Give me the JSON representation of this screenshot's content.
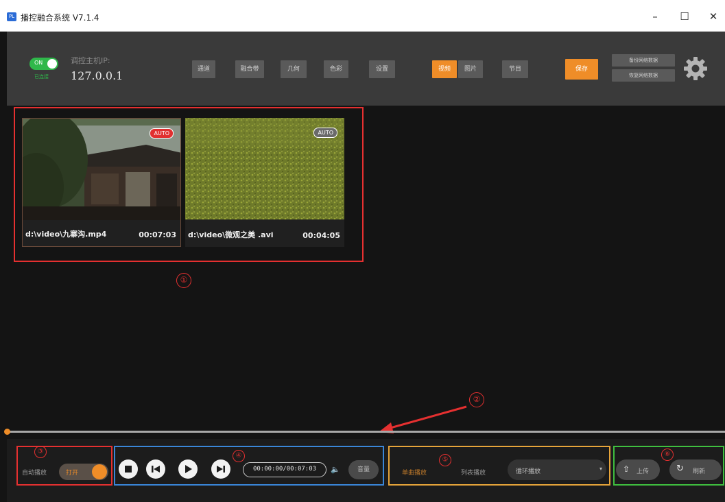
{
  "window": {
    "title": "播控融合系统 V7.1.4",
    "app_icon_text": "PL",
    "minimize": "–",
    "maximize": "☐",
    "close": "✕"
  },
  "toolbar": {
    "toggle_label": "ON",
    "conn_status": "已连接",
    "ip_label": "调控主机IP:",
    "ip_value": "127.0.0.1",
    "buttons": [
      "通道",
      "融合带",
      "几何",
      "色彩",
      "设置"
    ],
    "media_tabs": [
      "视频",
      "图片"
    ],
    "program_button": "节目",
    "save_button": "保存",
    "backup_button": "备份网络数据",
    "restore_button": "恢复网络数据"
  },
  "media": {
    "items": [
      {
        "path": "d:\\video\\九寨沟.mp4",
        "duration": "00:07:03",
        "badge": "AUTO",
        "badge_active": true
      },
      {
        "path": "d:\\video\\微观之美 .avi",
        "duration": "00:04:05",
        "badge": "AUTO",
        "badge_active": false
      }
    ]
  },
  "annotations": [
    "①",
    "②",
    "③",
    "④",
    "⑤",
    "⑥"
  ],
  "playback": {
    "progress_fraction": 0.0,
    "autoplay_label": "自动播放",
    "autoplay_value": "打开",
    "time_display": "00:00:00/00:07:03",
    "volume_icon": "🔈",
    "volume_button": "音量",
    "single_play": "单曲播放",
    "list_play": "列表播放",
    "loop_mode": "循环播放",
    "upload_button": "上传",
    "refresh_button": "刷新"
  },
  "colors": {
    "accent": "#ef8d28",
    "on_green": "#2fb84a",
    "annotation_red": "#e53030",
    "box_blue": "#3a86d8",
    "box_orange": "#e6a43a",
    "box_green": "#3fbf3f"
  }
}
